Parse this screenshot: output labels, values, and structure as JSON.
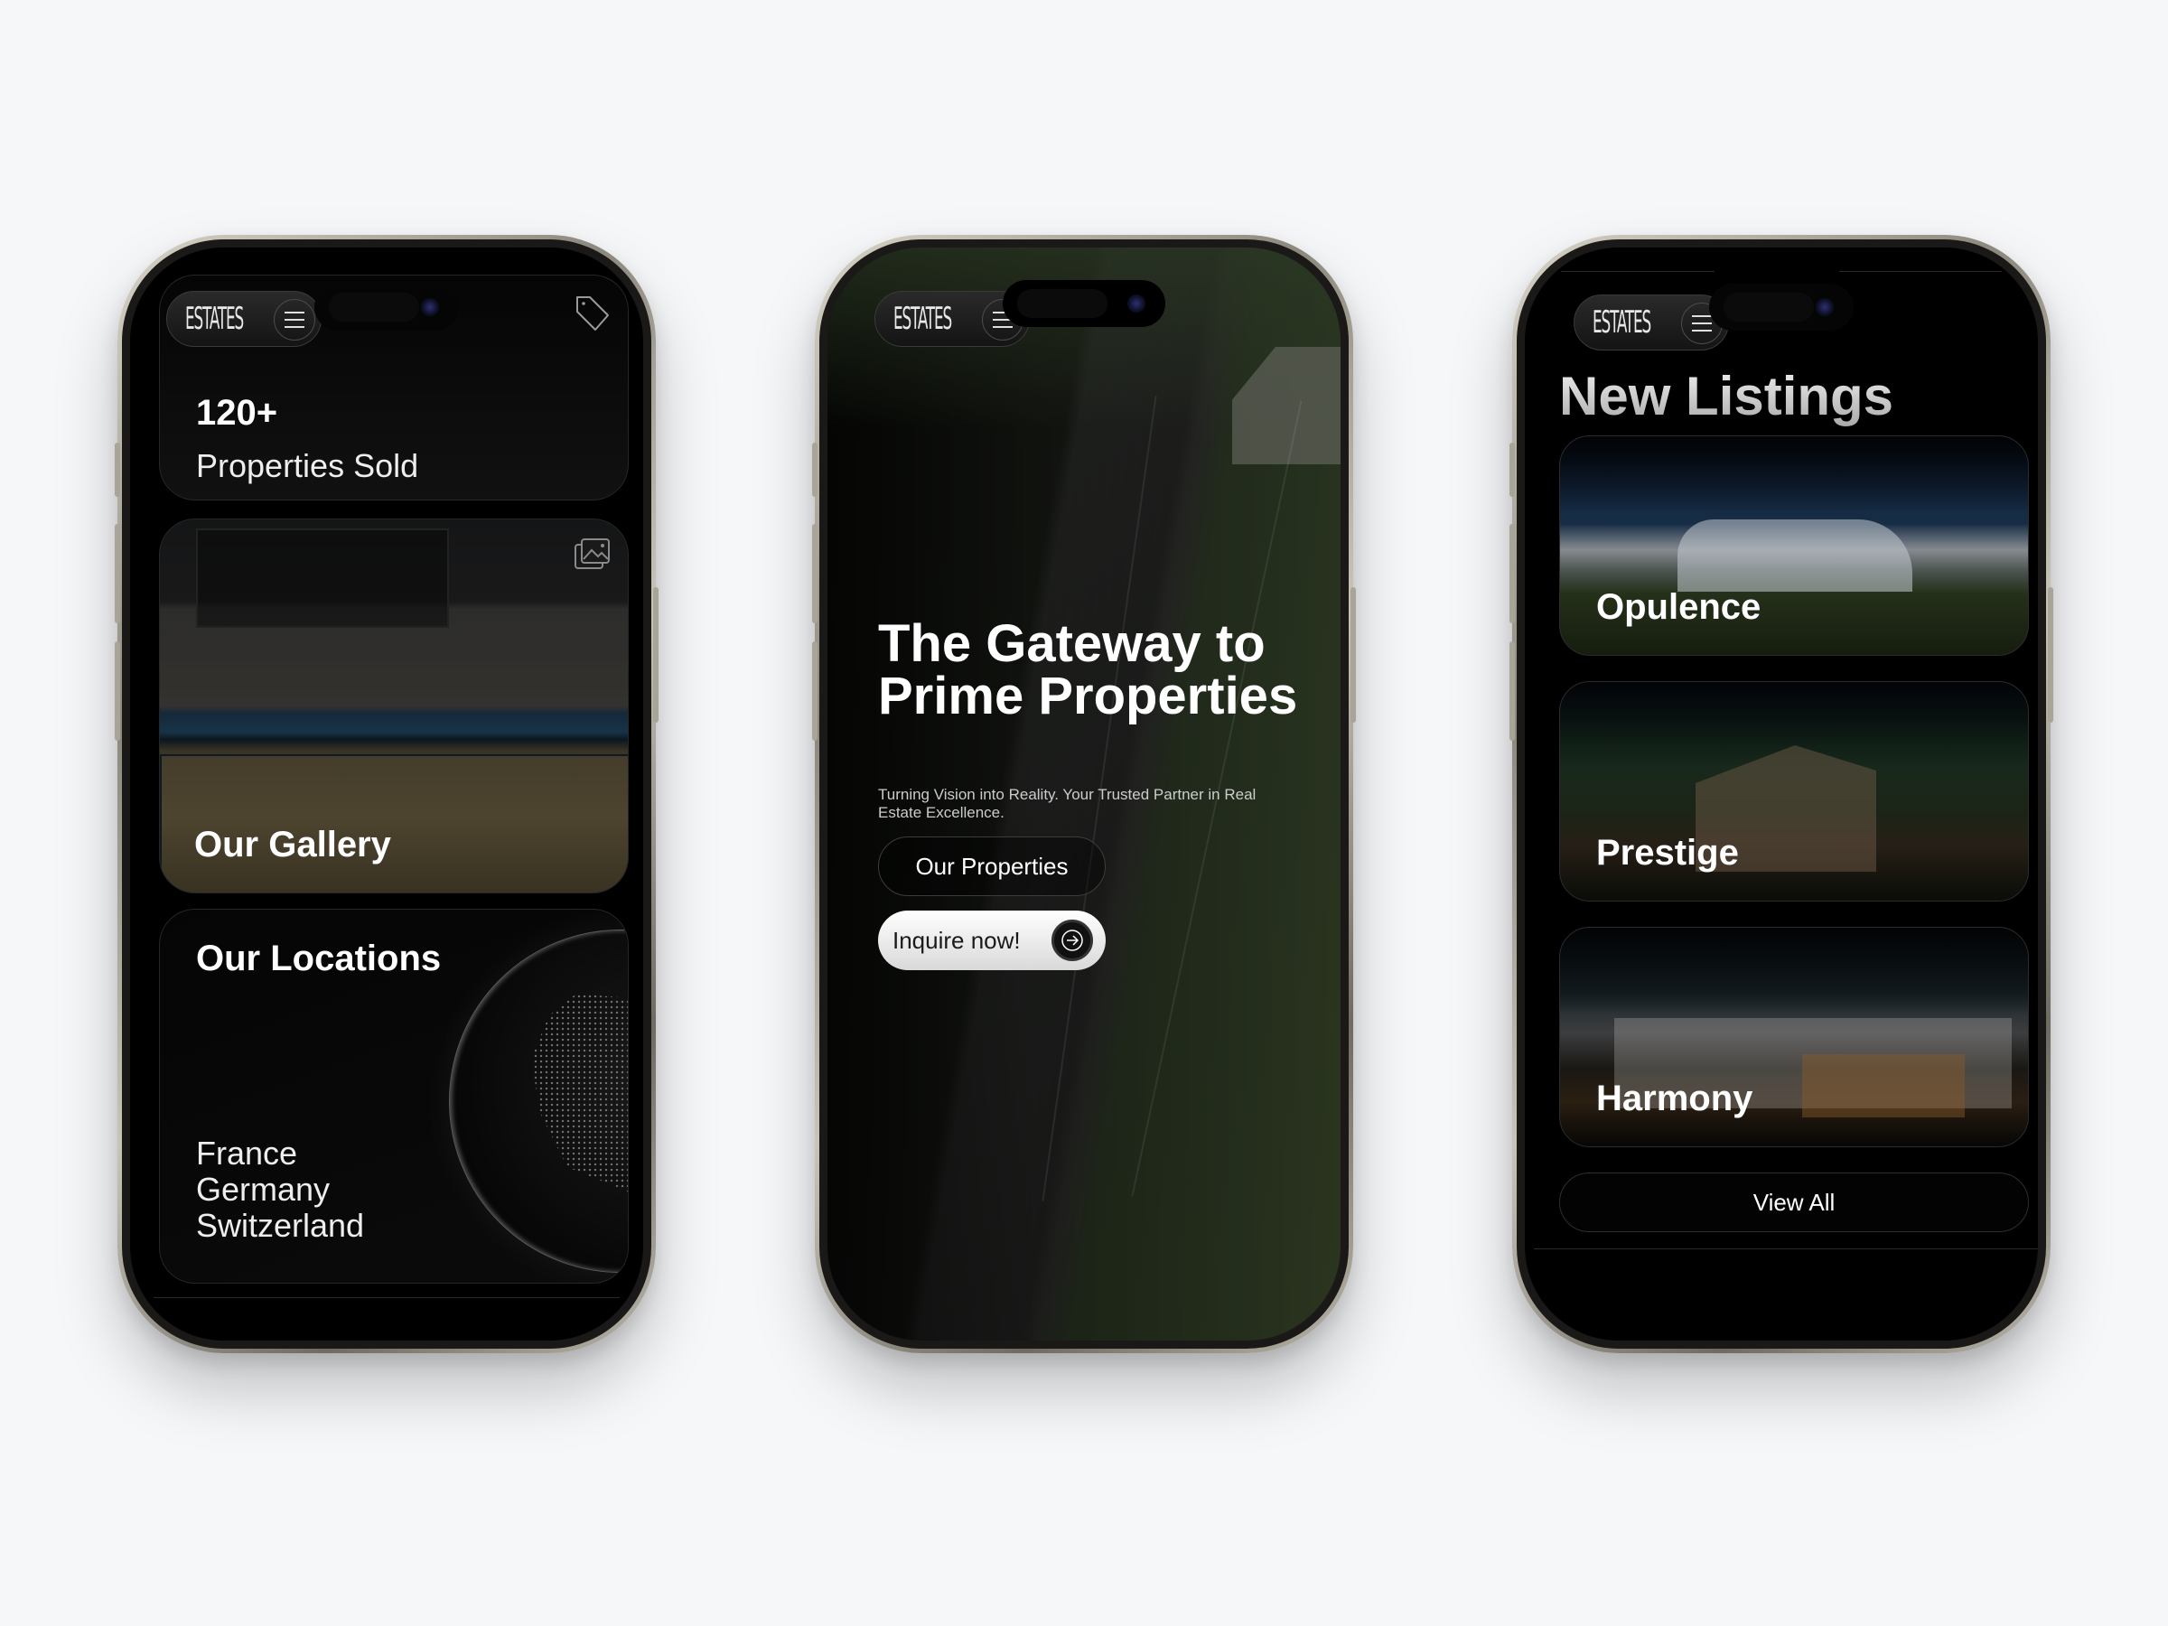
{
  "brand": {
    "logo": "ESTATES"
  },
  "icons": {
    "menu": "hamburger-icon",
    "tag": "tag-icon",
    "gallery": "images-icon",
    "arrow": "arrow-right-icon"
  },
  "screen1": {
    "stat": {
      "value": "120+",
      "label": "Properties Sold"
    },
    "gallery": {
      "title": "Our Gallery"
    },
    "locations": {
      "title": "Our Locations",
      "items": [
        "France",
        "Germany",
        "Switzerland"
      ]
    }
  },
  "screen2": {
    "hero_title": "The Gateway to Prime Properties",
    "hero_subtitle": "Turning Vision into Reality. Your Trusted Partner in Real Estate Excellence.",
    "primary_button": "Our Properties",
    "cta_button": "Inquire now!"
  },
  "screen3": {
    "title": "New Listings",
    "listings": [
      {
        "name": "Opulence"
      },
      {
        "name": "Prestige"
      },
      {
        "name": "Harmony"
      }
    ],
    "view_all": "View All"
  },
  "colors": {
    "background": "#f6f7f9",
    "screen": "#000000",
    "text": "#ffffff",
    "frame": "#b8b3a7"
  }
}
